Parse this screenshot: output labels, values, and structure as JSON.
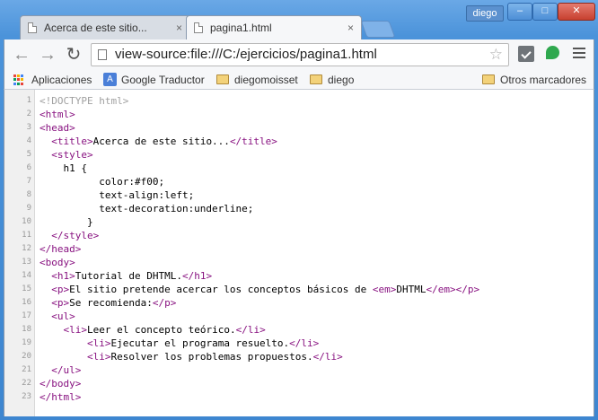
{
  "window": {
    "user": "diego",
    "controls": {
      "minimize": "–",
      "maximize": "□",
      "close": "✕"
    }
  },
  "tabs": [
    {
      "title": "Acerca de este sitio...",
      "close": "×",
      "active": false
    },
    {
      "title": "pagina1.html",
      "close": "×",
      "active": true
    }
  ],
  "toolbar": {
    "back": "←",
    "forward": "→",
    "reload": "↻",
    "url": "view-source:file:///C:/ejercicios/pagina1.html",
    "star": "☆"
  },
  "bookmarks": {
    "apps": "Aplicaciones",
    "items": [
      "Google Traductor",
      "diegomoisset",
      "diego"
    ],
    "other": "Otros marcadores"
  },
  "source_lines": [
    {
      "n": "1",
      "text": "<!DOCTYPE html>"
    },
    {
      "n": "2",
      "text": "<html>"
    },
    {
      "n": "3",
      "text": "<head>"
    },
    {
      "n": "4",
      "text": "  <title>Acerca de este sitio...</title>"
    },
    {
      "n": "5",
      "text": "  <style>"
    },
    {
      "n": "6",
      "text": "    h1 {"
    },
    {
      "n": "7",
      "text": "          color:#f00;"
    },
    {
      "n": "8",
      "text": "          text-align:left;"
    },
    {
      "n": "9",
      "text": "          text-decoration:underline;"
    },
    {
      "n": "10",
      "text": "        }"
    },
    {
      "n": "11",
      "text": "  </style>"
    },
    {
      "n": "12",
      "text": "</head>"
    },
    {
      "n": "13",
      "text": "<body>"
    },
    {
      "n": "14",
      "text": "  <h1>Tutorial de DHTML.</h1>"
    },
    {
      "n": "15",
      "text": "  <p>El sitio pretende acercar los conceptos básicos de <em>DHTML</em></p>"
    },
    {
      "n": "16",
      "text": "  <p>Se recomienda:</p>"
    },
    {
      "n": "17",
      "text": "  <ul>"
    },
    {
      "n": "18",
      "text": "    <li>Leer el concepto teórico.</li>"
    },
    {
      "n": "19",
      "text": "        <li>Ejecutar el programa resuelto.</li>"
    },
    {
      "n": "20",
      "text": "        <li>Resolver los problemas propuestos.</li>"
    },
    {
      "n": "21",
      "text": "  </ul>"
    },
    {
      "n": "22",
      "text": "</body>"
    },
    {
      "n": "23",
      "text": "</html>"
    }
  ],
  "colors": {
    "tag": "#881280",
    "comment": "#a0a0a0",
    "text": "#000000",
    "line_number": "#999999"
  }
}
